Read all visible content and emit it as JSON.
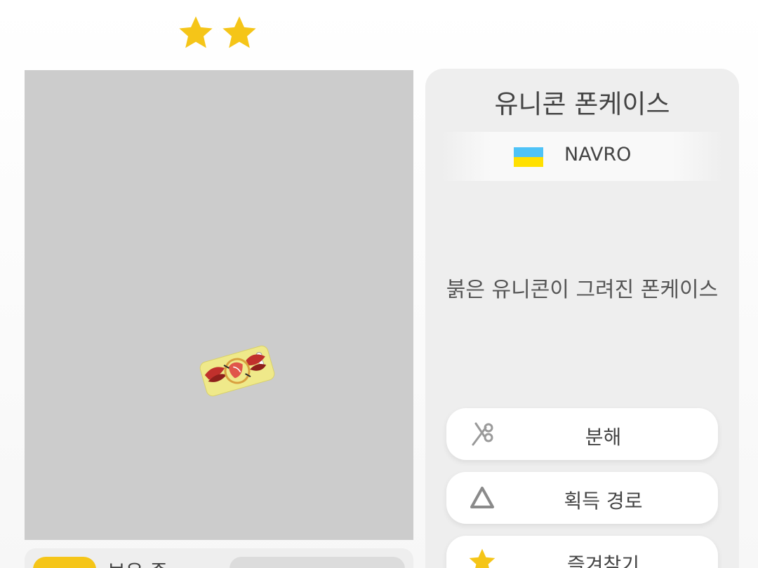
{
  "rarity": {
    "stars": 2,
    "icon": "star-icon",
    "color": "#f5c518"
  },
  "preview": {
    "background": "#cccccc",
    "item_icon": "phone-case-image"
  },
  "item": {
    "name": "유니콘 폰케이스",
    "brand": {
      "name": "NAVRO",
      "flag_icon": "ukraine-flag-icon"
    },
    "description": "붉은 유니콘이 그려진 폰케이스"
  },
  "actions": {
    "dismantle": {
      "label": "분해",
      "icon": "scissors-icon"
    },
    "source": {
      "label": "획득 경로",
      "icon": "triangle-icon"
    },
    "favorite": {
      "label": "즐겨찾기",
      "icon": "star-icon"
    }
  },
  "owned": {
    "label": "보유 중"
  }
}
